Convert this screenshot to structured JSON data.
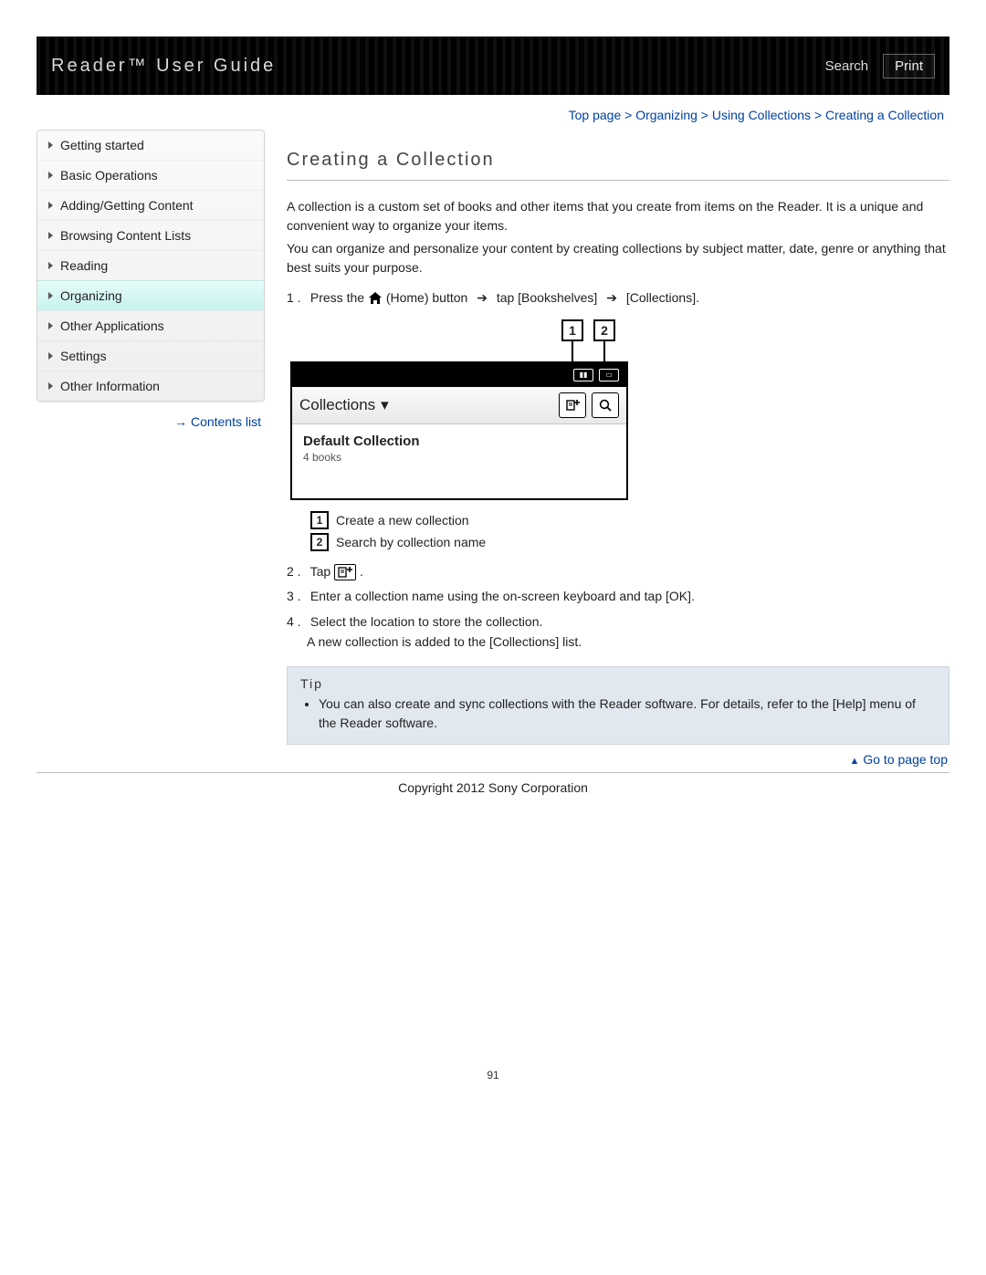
{
  "header": {
    "title": "Reader™ User Guide",
    "search": "Search",
    "print": "Print"
  },
  "breadcrumb": {
    "items": [
      "Top page",
      "Organizing",
      "Using Collections",
      "Creating a Collection"
    ],
    "sep": " > "
  },
  "sidebar": {
    "items": [
      {
        "label": "Getting started",
        "active": false
      },
      {
        "label": "Basic Operations",
        "active": false
      },
      {
        "label": "Adding/Getting Content",
        "active": false
      },
      {
        "label": "Browsing Content Lists",
        "active": false
      },
      {
        "label": "Reading",
        "active": false
      },
      {
        "label": "Organizing",
        "active": true
      },
      {
        "label": "Other Applications",
        "active": false
      },
      {
        "label": "Settings",
        "active": false
      },
      {
        "label": "Other Information",
        "active": false
      }
    ],
    "contents_link": "Contents list"
  },
  "page": {
    "title": "Creating a Collection",
    "intro": [
      "A collection is a custom set of books and other items that you create from items on the Reader. It is a unique and convenient way to organize your items.",
      "You can organize and personalize your content by creating collections by subject matter, date, genre or anything that best suits your purpose."
    ],
    "step1": {
      "num": "1 .",
      "a": "Press the ",
      "b": " (Home) button ",
      "c": " tap [Bookshelves] ",
      "d": " [Collections]."
    },
    "device": {
      "toolbar_title": "Collections",
      "body_title": "Default Collection",
      "body_sub": "4 books",
      "callouts": {
        "one": "1",
        "two": "2"
      }
    },
    "legend": {
      "one": "Create a new collection",
      "two": "Search by collection name"
    },
    "step2": {
      "num": "2 .",
      "a": "Tap ",
      "b": "."
    },
    "step3": {
      "num": "3 .",
      "text": "Enter a collection name using the on-screen keyboard and tap [OK]."
    },
    "step4": {
      "num": "4 .",
      "a": "Select the location to store the collection.",
      "b": "A new collection is added to the [Collections] list."
    },
    "tip": {
      "title": "Tip",
      "text": "You can also create and sync collections with the Reader software. For details, refer to the [Help] menu of the Reader software."
    },
    "page_top": "Go to page top",
    "copyright": "Copyright 2012 Sony Corporation",
    "page_number": "91"
  }
}
